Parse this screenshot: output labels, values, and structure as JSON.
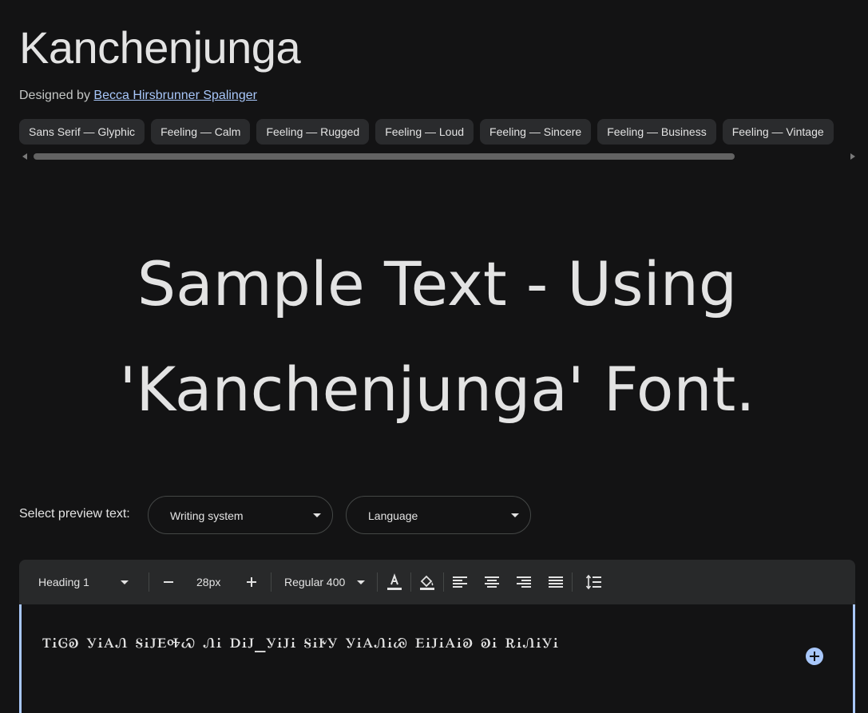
{
  "font": {
    "name": "Kanchenjunga",
    "designed_by_prefix": "Designed by",
    "designer": "Becca Hirsbrunner Spalinger"
  },
  "tags": [
    "Sans Serif — Glyphic",
    "Feeling — Calm",
    "Feeling — Rugged",
    "Feeling — Loud",
    "Feeling — Sincere",
    "Feeling — Business",
    "Feeling — Vintage"
  ],
  "sample": {
    "line1": "Sample Text - Using",
    "line2": "'Kanchenjunga' Font."
  },
  "preview": {
    "label": "Select preview text:",
    "writing_system": "Writing system",
    "language": "Language"
  },
  "toolbar": {
    "style": "Heading 1",
    "size": "28px",
    "weight": "Regular 400"
  },
  "editor": {
    "text": "ꭲꭵꮆꭷ ꭹꭵꭺꮑ ꭶꭵꭻꭼꭽꮗ ꮑꭵ ꭰꭵꭻ_ꭹꭵꭻꭵ ꭶꭵꭸꭹ ꭹꭵꭺꮑꭵꮚ ꭼꭵꭻꭵꭺꭵꭷ ꭷꭵ ꭱꭵꮑꭵꭹꭵ"
  },
  "colors": {
    "background": "#131314",
    "chip": "#2a2b2d",
    "link": "#a8c7fa",
    "toolbar": "#28292a",
    "editor_accent": "#a8c7fa"
  }
}
